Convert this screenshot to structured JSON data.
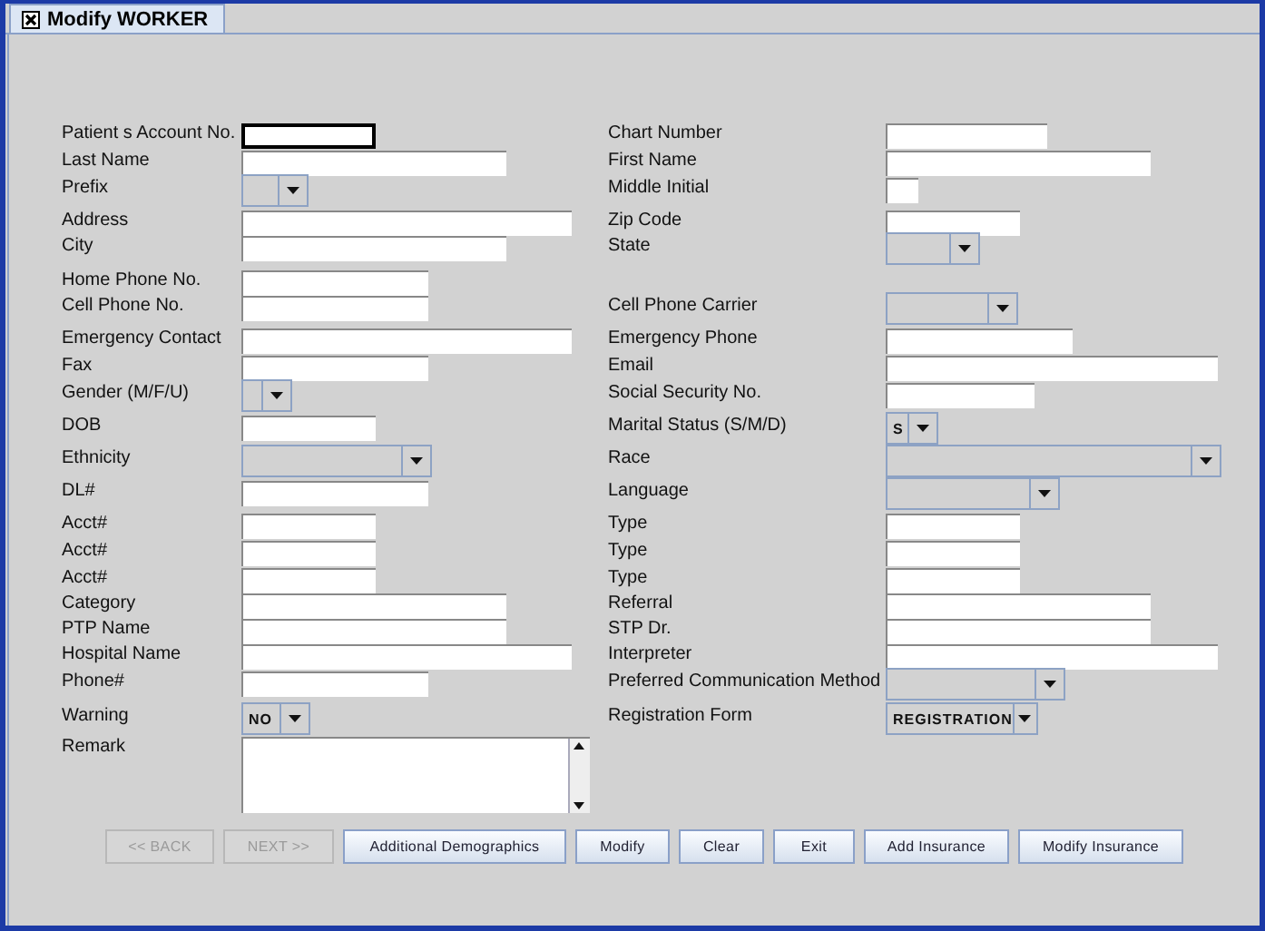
{
  "window": {
    "tab": {
      "label": "Modify WORKER",
      "selected": true
    }
  },
  "rows": [
    {
      "left": {
        "label": "Patient s Account No.",
        "kind": "text",
        "focused": true
      },
      "right": {
        "label": "Chart Number",
        "kind": "text"
      }
    },
    {
      "left": {
        "label": "Last Name",
        "kind": "text"
      },
      "right": {
        "label": "First Name",
        "kind": "text"
      }
    },
    {
      "left": {
        "label": "Prefix",
        "kind": "combo"
      },
      "right": {
        "label": "Middle Initial",
        "kind": "text"
      }
    },
    {
      "left": {
        "label": "Address",
        "kind": "text"
      },
      "right": {
        "label": "Zip Code",
        "kind": "text"
      }
    },
    {
      "left": {
        "label": "City",
        "kind": "text"
      },
      "right": {
        "label": "State",
        "kind": "combo"
      }
    },
    {
      "left": {
        "label": "Home Phone No.",
        "kind": "text"
      }
    },
    {
      "left": {
        "label": "Cell Phone No.",
        "kind": "text"
      },
      "right": {
        "label": "Cell Phone Carrier",
        "kind": "combo"
      }
    },
    {
      "left": {
        "label": "Emergency Contact",
        "kind": "text"
      },
      "right": {
        "label": "Emergency Phone",
        "kind": "text"
      }
    },
    {
      "left": {
        "label": "Fax",
        "kind": "text"
      },
      "right": {
        "label": "Email",
        "kind": "text"
      }
    },
    {
      "left": {
        "label": "Gender (M/F/U)",
        "kind": "combo"
      },
      "right": {
        "label": "Social Security No.",
        "kind": "text"
      }
    },
    {
      "left": {
        "label": "DOB",
        "kind": "text"
      },
      "right": {
        "label": "Marital Status (S/M/D)",
        "kind": "combo",
        "value": "S"
      }
    },
    {
      "left": {
        "label": "Ethnicity",
        "kind": "combo"
      },
      "right": {
        "label": "Race",
        "kind": "combo"
      }
    },
    {
      "left": {
        "label": "DL#",
        "kind": "text"
      },
      "right": {
        "label": "Language",
        "kind": "combo"
      }
    },
    {
      "left": {
        "label": "Acct#",
        "kind": "text"
      },
      "right": {
        "label": "Type",
        "kind": "text"
      }
    },
    {
      "left": {
        "label": "Acct#",
        "kind": "text"
      },
      "right": {
        "label": "Type",
        "kind": "text"
      }
    },
    {
      "left": {
        "label": "Acct#",
        "kind": "text"
      },
      "right": {
        "label": "Type",
        "kind": "text"
      }
    },
    {
      "left": {
        "label": "Category",
        "kind": "text"
      },
      "right": {
        "label": "Referral",
        "kind": "text"
      }
    },
    {
      "left": {
        "label": "PTP Name",
        "kind": "text"
      },
      "right": {
        "label": "STP Dr.",
        "kind": "text"
      }
    },
    {
      "left": {
        "label": "Hospital Name",
        "kind": "text"
      },
      "right": {
        "label": "Interpreter",
        "kind": "text"
      }
    },
    {
      "left": {
        "label": "Phone#",
        "kind": "text"
      },
      "right": {
        "label": "Preferred Communication Method",
        "kind": "combo"
      }
    },
    {
      "left": {
        "label": "Warning",
        "kind": "combo",
        "value": "NO"
      },
      "right": {
        "label": "Registration Form",
        "kind": "combo",
        "value": "REGISTRATION"
      }
    },
    {
      "left": {
        "label": "Remark",
        "kind": "textarea"
      }
    }
  ],
  "buttons": [
    {
      "label": "<< BACK",
      "disabled": true
    },
    {
      "label": "NEXT >>",
      "disabled": true
    },
    {
      "label": "Additional Demographics",
      "disabled": false
    },
    {
      "label": "Modify",
      "disabled": false
    },
    {
      "label": "Clear",
      "disabled": false
    },
    {
      "label": "Exit",
      "disabled": false
    },
    {
      "label": "Add Insurance",
      "disabled": false
    },
    {
      "label": "Modify Insurance",
      "disabled": false
    }
  ]
}
